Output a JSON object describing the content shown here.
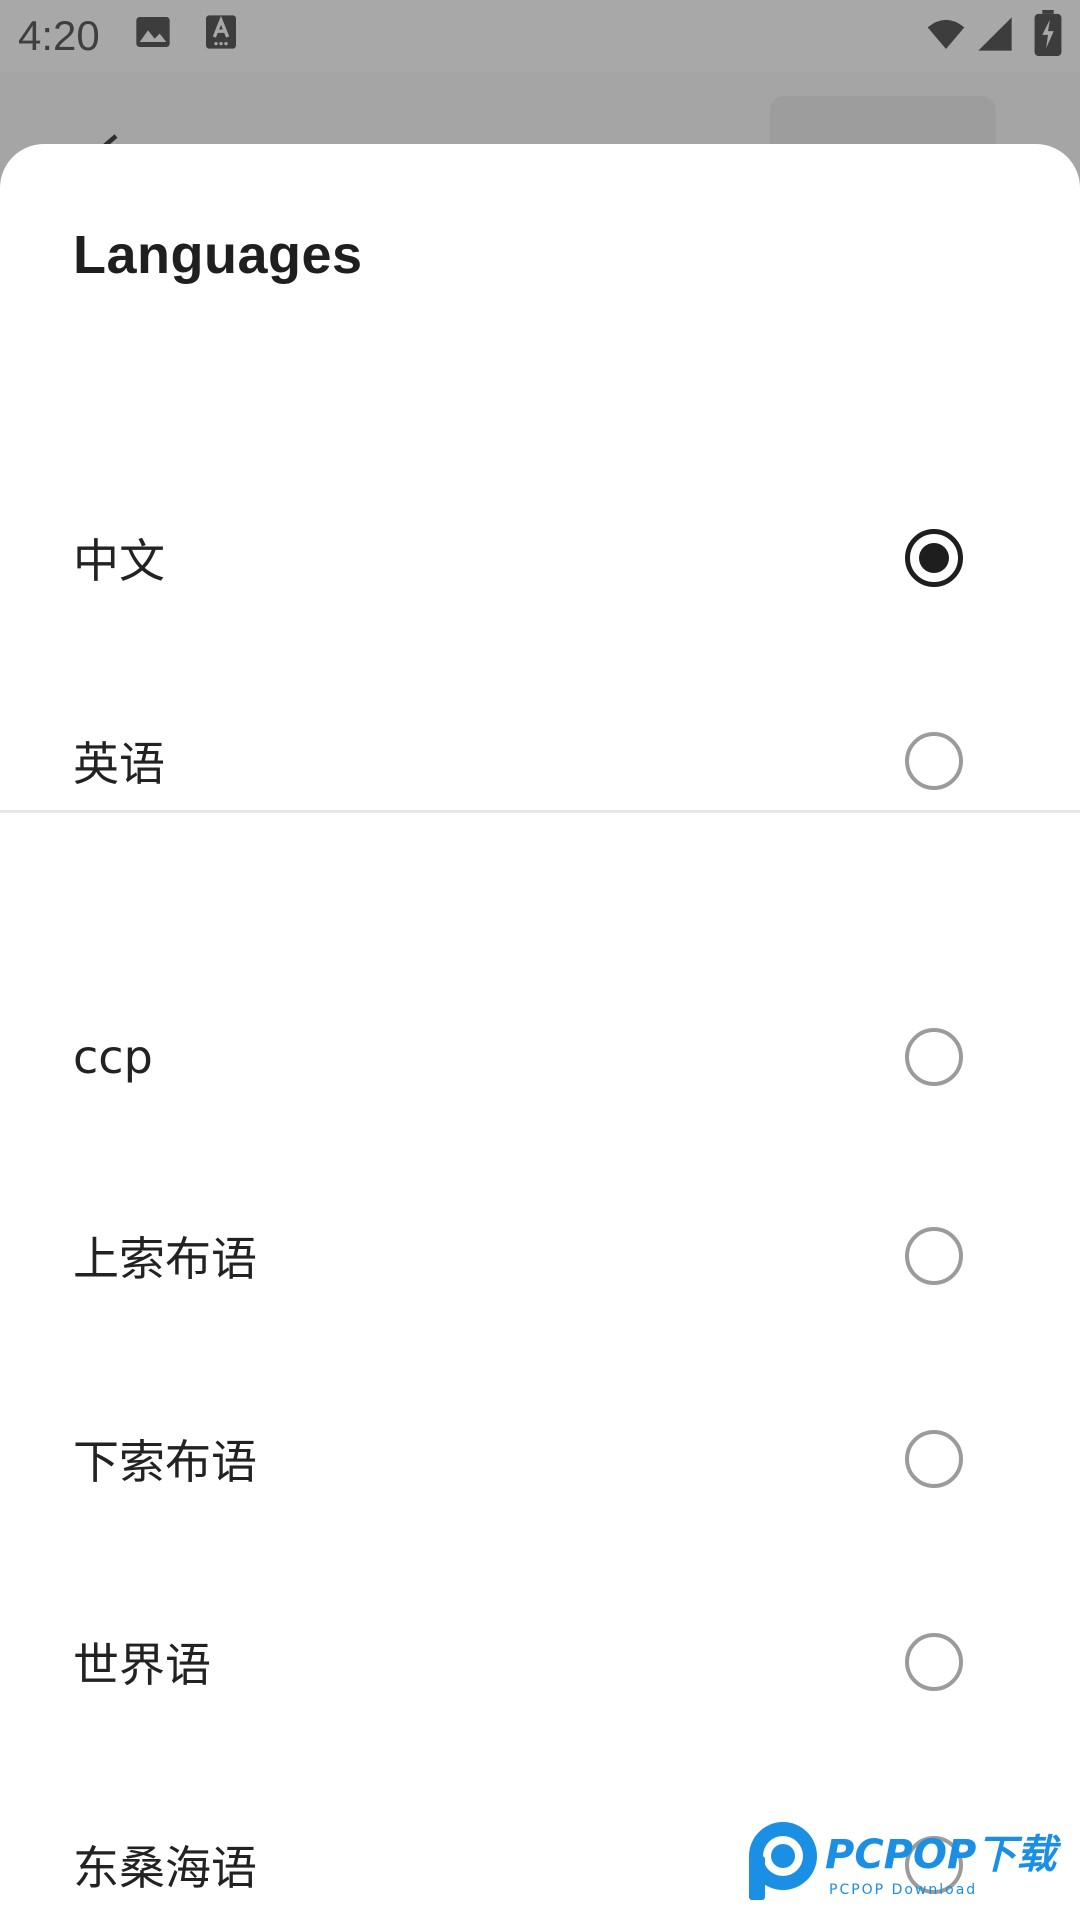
{
  "status_bar": {
    "time": "4:20",
    "icons": [
      "gallery-icon",
      "keyboard-a-icon",
      "wifi-icon",
      "signal-icon",
      "battery-charging-icon"
    ]
  },
  "sheet": {
    "title": "Languages",
    "options": [
      {
        "label": "中文",
        "selected": true
      },
      {
        "label": "英语",
        "selected": false
      },
      {
        "label": "ccp",
        "selected": false
      },
      {
        "label": "上索布语",
        "selected": false
      },
      {
        "label": "下索布语",
        "selected": false
      },
      {
        "label": "世界语",
        "selected": false
      },
      {
        "label": "东桑海语",
        "selected": false
      }
    ]
  },
  "watermark": {
    "brand": "PCPOP下载",
    "sub": "PCPOP Download"
  },
  "colors": {
    "scrim": "#a5a5a5",
    "sheet_bg": "#ffffff",
    "radio_checked": "#1e1e1e",
    "radio_unchecked": "#9b9b9b",
    "watermark_blue": "#1a8fe3"
  }
}
